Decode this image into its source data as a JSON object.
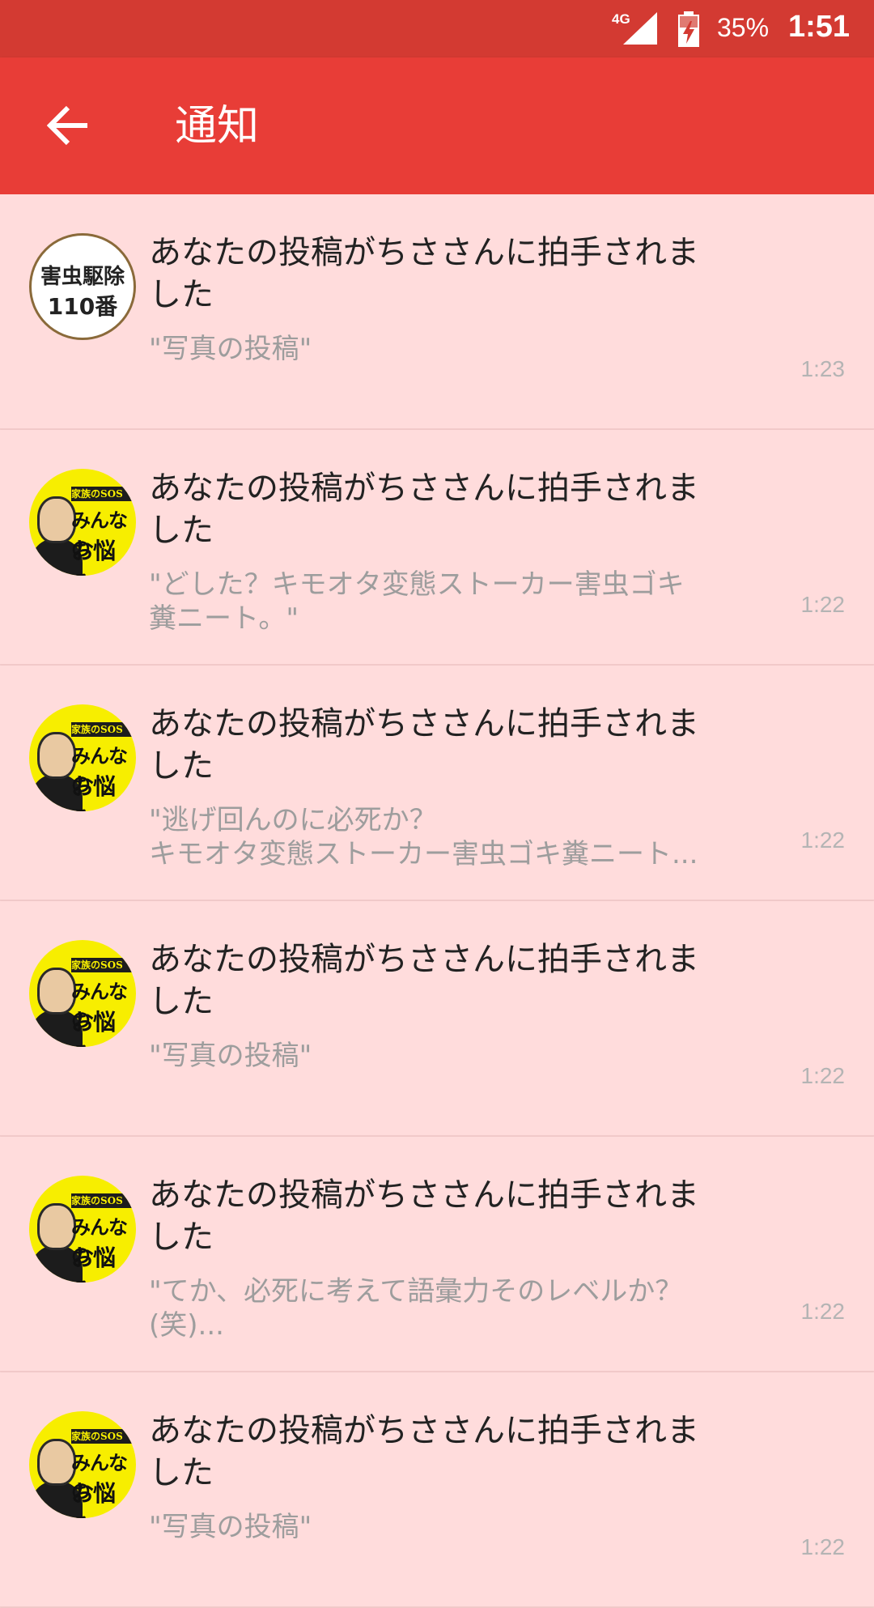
{
  "status_bar": {
    "network": "4G",
    "battery": "35%",
    "time": "1:51"
  },
  "app_bar": {
    "title": "通知"
  },
  "avatars": {
    "pest": {
      "line1": "害虫駆除",
      "line2": "110番"
    },
    "family": {
      "sos": "家族のSOS",
      "minna": "みんなの",
      "nayami": "お悩み"
    }
  },
  "notifications": [
    {
      "avatar": "pest",
      "title": "あなたの投稿がちささんに拍手されま\nした",
      "quote": "\"写真の投稿\"",
      "time": "1:23"
    },
    {
      "avatar": "family",
      "title": "あなたの投稿がちささんに拍手されま\nした",
      "quote": "\"どした？キモオタ変態ストーカー害虫ゴキ\n糞ニート。\"",
      "time": "1:22"
    },
    {
      "avatar": "family",
      "title": "あなたの投稿がちささんに拍手されま\nした",
      "quote": "\"逃げ回んのに必死か？\nキモオタ変態ストーカー害虫ゴキ糞ニート...",
      "time": "1:22"
    },
    {
      "avatar": "family",
      "title": "あなたの投稿がちささんに拍手されま\nした",
      "quote": "\"写真の投稿\"",
      "time": "1:22"
    },
    {
      "avatar": "family",
      "title": "あなたの投稿がちささんに拍手されま\nした",
      "quote": "\"てか、必死に考えて語彙力そのレベルか？\n(笑)...",
      "time": "1:22"
    },
    {
      "avatar": "family",
      "title": "あなたの投稿がちささんに拍手されま\nした",
      "quote": "\"写真の投稿\"",
      "time": "1:22"
    }
  ]
}
